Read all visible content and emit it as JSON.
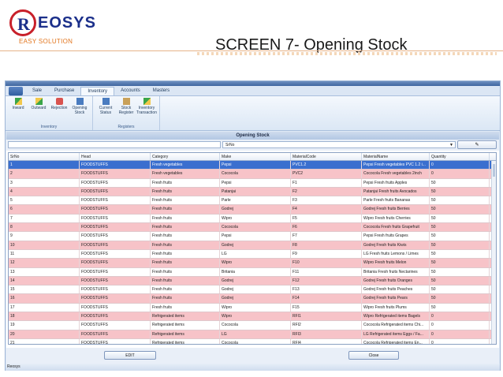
{
  "header": {
    "logo_letter": "R",
    "logo_name": "EOSYS",
    "tagline": "EASY SOLUTION",
    "title": "SCREEN 7-  Opening Stock"
  },
  "menu": {
    "tabs": [
      "Sale",
      "Purchase",
      "Inventory",
      "Accounts",
      "Masters"
    ],
    "active_tab": "Inventory"
  },
  "ribbon": {
    "inventory": {
      "buttons": [
        {
          "label": "Inward",
          "icon": "inward-icon"
        },
        {
          "label": "Outward",
          "icon": "outward-icon"
        },
        {
          "label": "Rejection",
          "icon": "rejection-icon"
        },
        {
          "label": "Opening Stock",
          "icon": "opening-stock-icon"
        }
      ],
      "group_name": "Inventory"
    },
    "registers": {
      "buttons": [
        {
          "label": "Current Status",
          "icon": "current-status-icon"
        },
        {
          "label": "Stock Register",
          "icon": "stock-register-icon"
        },
        {
          "label": "Inventory Transaction",
          "icon": "inventory-transaction-icon"
        }
      ],
      "group_name": "Registers"
    }
  },
  "panel": {
    "title": "Opening Stock",
    "filter_field": "SrNo"
  },
  "grid": {
    "columns": [
      "SrNo",
      "Head",
      "Category",
      "Make",
      "MaterialCode",
      "MaterialName",
      "Quantity"
    ],
    "rows": [
      [
        "1",
        "FOODSTUFFS",
        "Fresh vegetables",
        "Pepsi",
        "PVC1.2",
        "Pepsi Fresh vegetables PVC 1.2 i...",
        "0"
      ],
      [
        "2",
        "FOODSTUFFS",
        "Fresh vegetables",
        "Cococola",
        "PVC2",
        "Cococola Fresh vegetables 2inch",
        "0"
      ],
      [
        "3",
        "FOODSTUFFS",
        "Fresh fruits",
        "Pepsi",
        "F1",
        "Pepsi Fresh fruits Apples",
        "50"
      ],
      [
        "4",
        "FOODSTUFFS",
        "Fresh fruits",
        "Patanjai",
        "F2",
        "Patanjai Fresh fruits Avocados",
        "50"
      ],
      [
        "5",
        "FOODSTUFFS",
        "Fresh fruits",
        "Parle",
        "F3",
        "Parle Fresh fruits Bananas",
        "50"
      ],
      [
        "6",
        "FOODSTUFFS",
        "Fresh fruits",
        "Godrej",
        "F4",
        "Godrej Fresh fruits Berries",
        "50"
      ],
      [
        "7",
        "FOODSTUFFS",
        "Fresh fruits",
        "Wipro",
        "F5",
        "Wipro Fresh fruits Cherries",
        "50"
      ],
      [
        "8",
        "FOODSTUFFS",
        "Fresh fruits",
        "Cococola",
        "F6",
        "Cococola Fresh fruits Grapefruit",
        "50"
      ],
      [
        "9",
        "FOODSTUFFS",
        "Fresh fruits",
        "Pepsi",
        "F7",
        "Pepsi Fresh fruits Grapes",
        "50"
      ],
      [
        "10",
        "FOODSTUFFS",
        "Fresh fruits",
        "Godrej",
        "F8",
        "Godrej Fresh fruits Kiwis",
        "50"
      ],
      [
        "11",
        "FOODSTUFFS",
        "Fresh fruits",
        "LG",
        "F9",
        "LG Fresh fruits Lemons / Limes",
        "50"
      ],
      [
        "12",
        "FOODSTUFFS",
        "Fresh fruits",
        "Wipro",
        "F10",
        "Wipro Fresh fruits Melon",
        "50"
      ],
      [
        "13",
        "FOODSTUFFS",
        "Fresh fruits",
        "Britania",
        "F11",
        "Britania Fresh fruits Nectarines",
        "50"
      ],
      [
        "14",
        "FOODSTUFFS",
        "Fresh fruits",
        "Godrej",
        "F12",
        "Godrej Fresh fruits Oranges",
        "50"
      ],
      [
        "15",
        "FOODSTUFFS",
        "Fresh fruits",
        "Godrej",
        "F13",
        "Godrej Fresh fruits Peaches",
        "50"
      ],
      [
        "16",
        "FOODSTUFFS",
        "Fresh fruits",
        "Godrej",
        "F14",
        "Godrej Fresh fruits Pears",
        "50"
      ],
      [
        "17",
        "FOODSTUFFS",
        "Fresh fruits",
        "Wipro",
        "F15",
        "Wipro Fresh fruits Plums",
        "50"
      ],
      [
        "18",
        "FOODSTUFFS",
        "Refrigerated items",
        "Wipro",
        "RFI1",
        "Wipro Refrigerated items Bagels",
        "0"
      ],
      [
        "19",
        "FOODSTUFFS",
        "Refrigerated items",
        "Cococola",
        "RFI2",
        "Cococola Refrigerated items Chi...",
        "0"
      ],
      [
        "20",
        "FOODSTUFFS",
        "Refrigerated items",
        "LG",
        "RFI3",
        "LG Refrigerated items Eggs / Fa...",
        "0"
      ],
      [
        "21",
        "FOODSTUFFS",
        "Refrigerated items",
        "Cococola",
        "RFI4",
        "Cococola Refrigerated items En...",
        "0"
      ]
    ]
  },
  "footer": {
    "edit_label": "EDIT",
    "close_label": "Close",
    "status": "Reosys"
  }
}
